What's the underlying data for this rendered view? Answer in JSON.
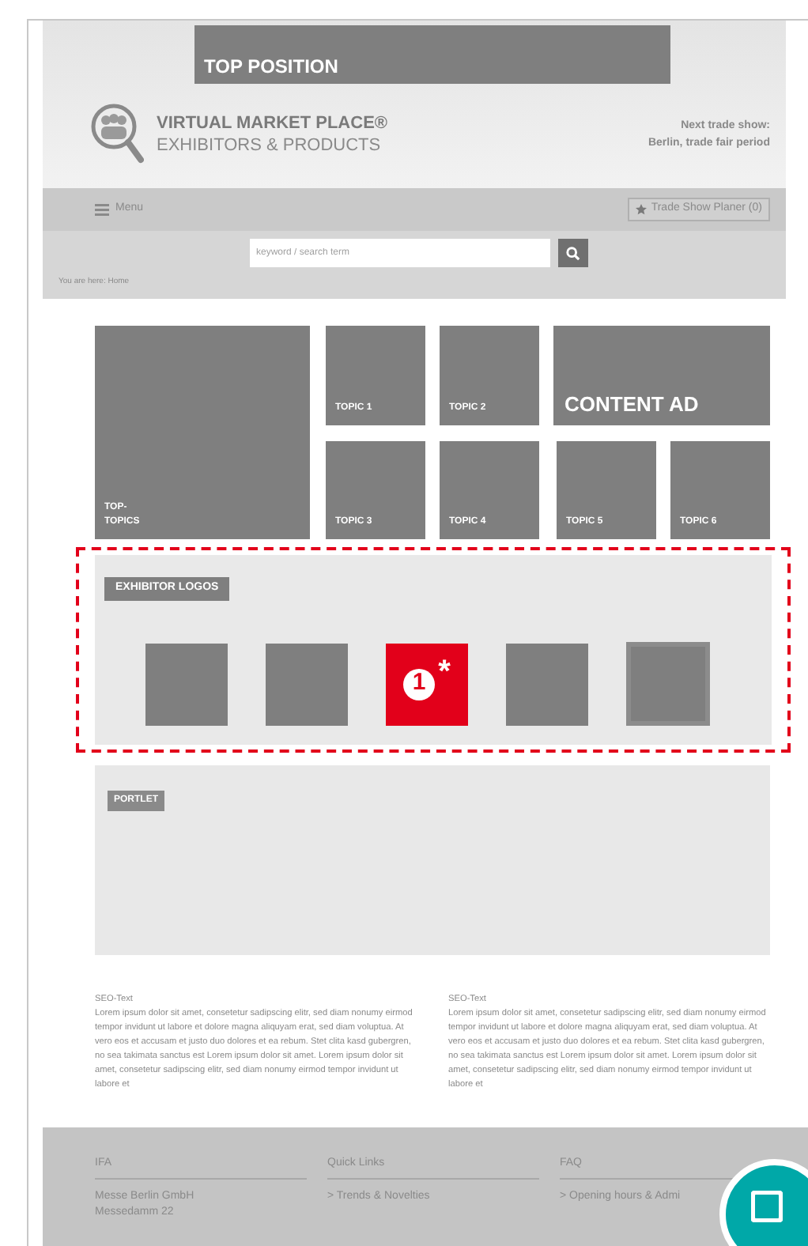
{
  "top_position": "TOP POSITION",
  "logo": {
    "title": "VIRTUAL MARKET PLACE®",
    "subtitle": "EXHIBITORS & PRODUCTS"
  },
  "next_show": {
    "label": "Next trade show:",
    "value": "Berlin, trade fair period"
  },
  "menu": "Menu",
  "planner": "Trade Show Planer (0)",
  "search": {
    "placeholder": "keyword / search term"
  },
  "breadcrumb": "You are here: Home",
  "top_topics": "TOP- TOPICS",
  "topics": [
    "TOPIC 1",
    "TOPIC 2",
    "TOPIC 3",
    "TOPIC 4",
    "TOPIC 5",
    "TOPIC 6"
  ],
  "content_ad": "CONTENT AD",
  "exhibitor_logos": {
    "label": "EXHIBITOR LOGOS",
    "logos": [
      {
        "kind": "placeholder"
      },
      {
        "kind": "placeholder"
      },
      {
        "kind": "marker",
        "number": "1",
        "note": "*"
      },
      {
        "kind": "placeholder"
      },
      {
        "kind": "framed"
      }
    ]
  },
  "portlet": "PORTLET",
  "seo": [
    {
      "title": "SEO-Text",
      "body": "Lorem ipsum dolor sit amet, consetetur sadipscing elitr, sed diam nonumy eirmod tempor invidunt ut labore et dolore magna aliquyam erat, sed diam voluptua. At vero eos et accusam et justo duo dolores et ea rebum. Stet clita kasd gubergren, no sea takimata sanctus est Lorem ipsum dolor sit amet. Lorem ipsum dolor sit amet, consetetur sadipscing elitr, sed diam nonumy eirmod tempor invidunt ut labore et"
    },
    {
      "title": "SEO-Text",
      "body": "Lorem ipsum dolor sit amet, consetetur sadipscing elitr, sed diam nonumy eirmod tempor invidunt ut labore et dolore magna aliquyam erat, sed diam voluptua. At vero eos et accusam et justo duo dolores et ea rebum. Stet clita kasd gubergren, no sea takimata sanctus est Lorem ipsum dolor sit amet. Lorem ipsum dolor sit amet, consetetur sadipscing elitr, sed diam nonumy eirmod tempor invidunt ut labore et"
    }
  ],
  "footer": [
    {
      "title": "IFA",
      "items": [
        "Messe Berlin GmbH",
        "Messedamm 22"
      ]
    },
    {
      "title": "Quick Links",
      "items": [
        "> Trends & Novelties"
      ]
    },
    {
      "title": "FAQ",
      "items": [
        "> Opening hours & Admi"
      ]
    }
  ]
}
